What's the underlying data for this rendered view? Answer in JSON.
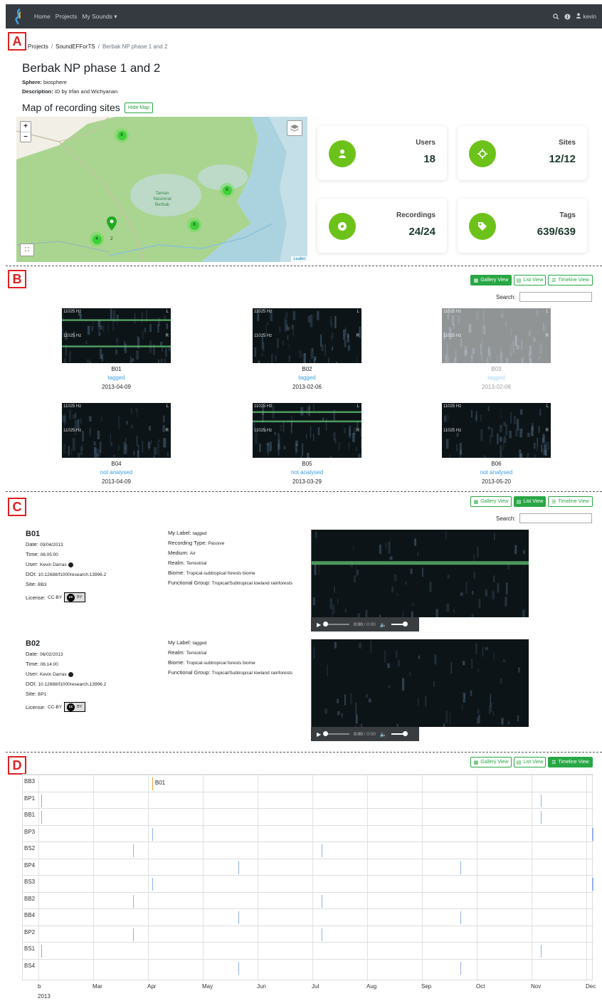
{
  "nav": {
    "home": "Home",
    "projects": "Projects",
    "my_sounds": "My Sounds",
    "user": "kevin"
  },
  "sections": {
    "a": "A",
    "b": "B",
    "c": "C",
    "d": "D"
  },
  "breadcrumb": {
    "projects": "Projects",
    "project": "SoundEFForTS",
    "current": "Berbak NP phase 1 and 2"
  },
  "collection": {
    "title": "Berbak NP phase 1 and 2",
    "sphere_label": "Sphere:",
    "sphere": "biosphere",
    "desc_label": "Description:",
    "description": "ID by Irfan and Wichyanan"
  },
  "map": {
    "title": "Map of recording sites",
    "hide_btn": "Hide Map",
    "zoom_in": "+",
    "zoom_out": "−",
    "area_label": "Taman Nasional Berbak",
    "attribution": "Leaflet",
    "markers": [
      "6",
      "6",
      "6",
      "4"
    ],
    "pin_label": "2"
  },
  "stats": [
    {
      "label": "Users",
      "value": "18",
      "icon": "user-icon"
    },
    {
      "label": "Sites",
      "value": "12/12",
      "icon": "crosshair-icon"
    },
    {
      "label": "Recordings",
      "value": "24/24",
      "icon": "disc-icon"
    },
    {
      "label": "Tags",
      "value": "639/639",
      "icon": "tag-icon"
    }
  ],
  "views": {
    "gallery": "Gallery View",
    "list": "List View",
    "timeline": "Timeline View"
  },
  "search_label": "Search:",
  "gallery": [
    {
      "name": "B01",
      "status": "tagged",
      "date": "2013-04-09",
      "hz": "11025 Hz",
      "l": "L",
      "r": "R"
    },
    {
      "name": "B02",
      "status": "tagged",
      "date": "2013-02-06",
      "hz": "11025 Hz",
      "l": "L",
      "r": "R"
    },
    {
      "name": "B03",
      "status": "tagged",
      "date": "2013-02-06",
      "hz": "11025 Hz",
      "l": "L",
      "r": "R"
    },
    {
      "name": "B04",
      "status": "not analysed",
      "date": "2013-04-09",
      "hz": "11025 Hz",
      "l": "L",
      "r": "R"
    },
    {
      "name": "B05",
      "status": "not analysed",
      "date": "2013-03-29",
      "hz": "11025 Hz",
      "l": "L",
      "r": "R"
    },
    {
      "name": "B06",
      "status": "not analysed",
      "date": "2013-05-20",
      "hz": "11025 Hz",
      "l": "L",
      "r": "R"
    }
  ],
  "list": [
    {
      "name": "B01",
      "date_label": "Date:",
      "date": "09/04/2013",
      "time_label": "Time:",
      "time": "06:05:00",
      "user_label": "User:",
      "user": "Kevin Darras",
      "doi_label": "DOI:",
      "doi": "10.12688/f1000research.13996.2",
      "site_label": "Site:",
      "site": "BB3",
      "license_label": "License:",
      "license": "CC-BY",
      "cc": "cc",
      "by": "BY",
      "props": [
        [
          "My Label:",
          "tagged"
        ],
        [
          "Recording Type:",
          "Passive"
        ],
        [
          "Medium:",
          "Air"
        ],
        [
          "Realm:",
          "Terrestrial"
        ],
        [
          "Biome:",
          "Tropical-subtropical forests biome"
        ],
        [
          "Functional Group:",
          "Tropical/Subtropical lowland rainforests"
        ]
      ],
      "time_display": "0:00",
      "duration": "0:00"
    },
    {
      "name": "B02",
      "date_label": "Date:",
      "date": "06/02/2013",
      "time_label": "Time:",
      "time": "06:14:00",
      "user_label": "User:",
      "user": "Kevin Darras",
      "doi_label": "DOI:",
      "doi": "10.12688/f1000research.13996.2",
      "site_label": "Site:",
      "site": "BP1",
      "license_label": "License:",
      "license": "CC-BY",
      "cc": "cc",
      "by": "BY",
      "props": [
        [
          "My Label:",
          "tagged"
        ],
        [
          "Realm:",
          "Terrestrial"
        ],
        [
          "Biome:",
          "Tropical-subtropical forests biome"
        ],
        [
          "Functional Group:",
          "Tropical/Subtropical lowland rainforests"
        ]
      ],
      "time_display": "0:00",
      "duration": "0:00"
    }
  ],
  "timeline": {
    "rows": [
      "BB3",
      "BP1",
      "BB1",
      "BP3",
      "BS2",
      "BP4",
      "BS3",
      "BB2",
      "BB4",
      "BP2",
      "BS1",
      "BS4"
    ],
    "b01_label": "B01",
    "months": [
      "b",
      "Mar",
      "Apr",
      "May",
      "Jun",
      "Jul",
      "Aug",
      "Sep",
      "Oct",
      "Nov",
      "Dec"
    ],
    "year": "2013",
    "events": [
      [
        0.205
      ],
      [
        0.005,
        0.905
      ],
      [
        0.005,
        0.905
      ],
      [
        0.205,
        0.998
      ],
      [
        0.17,
        0.51
      ],
      [
        0.36,
        0.76
      ],
      [
        0.205,
        0.998
      ],
      [
        0.17,
        0.51
      ],
      [
        0.36,
        0.76
      ],
      [
        0.17,
        0.51
      ],
      [
        0.005,
        0.905
      ],
      [
        0.36,
        0.76
      ]
    ]
  }
}
